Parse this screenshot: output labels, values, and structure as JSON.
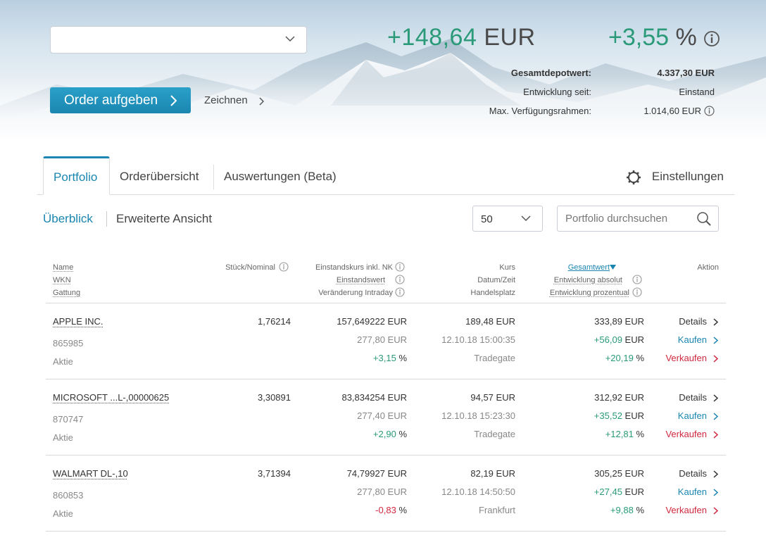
{
  "header": {
    "account_select_value": "",
    "total_change_abs": "+148,64",
    "total_change_abs_currency": "EUR",
    "total_change_pct": "+3,55",
    "total_change_pct_unit": "%",
    "order_button": "Order aufgeben",
    "zeichnen_link": "Zeichnen",
    "stats": [
      {
        "label": "Gesamtdepotwert:",
        "value": "4.337,30 EUR"
      },
      {
        "label": "Entwicklung seit:",
        "value": "Einstand"
      },
      {
        "label": "Max. Verfügungsrahmen:",
        "value": "1.014,60 EUR"
      }
    ]
  },
  "tabs": [
    {
      "label": "Portfolio",
      "active": true
    },
    {
      "label": "Orderübersicht",
      "active": false
    },
    {
      "label": "Auswertungen (Beta)",
      "active": false
    }
  ],
  "settings_label": "Einstellungen",
  "subnav": {
    "overview": "Überblick",
    "extended": "Erweiterte Ansicht"
  },
  "page_size": "50",
  "search_placeholder": "Portfolio durchsuchen",
  "columns": {
    "name": "Name",
    "wkn": "WKN",
    "gattung": "Gattung",
    "stueck": "Stück/Nominal",
    "einstandskurs": "Einstandskurs inkl. NK",
    "einstandswert": "Einstandswert",
    "veraenderung_intraday": "Veränderung Intraday",
    "kurs": "Kurs",
    "datum_zeit": "Datum/Zeit",
    "handelsplatz": "Handelsplatz",
    "gesamtwert": "Gesamtwert",
    "entwicklung_absolut": "Entwicklung absolut",
    "entwicklung_prozentual": "Entwicklung prozentual",
    "aktion": "Aktion"
  },
  "currency": "EUR",
  "pct_unit": "%",
  "actions": {
    "details": "Details",
    "buy": "Kaufen",
    "sell": "Verkaufen"
  },
  "rows": [
    {
      "name": "APPLE INC.",
      "wkn": "865985",
      "gattung": "Aktie",
      "stueck": "1,76214",
      "einstandskurs": "157,649222",
      "einstandswert": "277,80",
      "intraday": "+3,15",
      "kurs": "189,48",
      "datum": "12.10.18 15:00:35",
      "handelsplatz": "Tradegate",
      "gesamtwert": "333,89",
      "entw_abs": "+56,09",
      "entw_pct": "+20,19"
    },
    {
      "name": "MICROSOFT ...L-,00000625",
      "wkn": "870747",
      "gattung": "Aktie",
      "stueck": "3,30891",
      "einstandskurs": "83,834254",
      "einstandswert": "277,40",
      "intraday": "+2,90",
      "kurs": "94,57",
      "datum": "12.10.18 15:23:30",
      "handelsplatz": "Tradegate",
      "gesamtwert": "312,92",
      "entw_abs": "+35,52",
      "entw_pct": "+12,81"
    },
    {
      "name": "WALMART DL-,10",
      "wkn": "860853",
      "gattung": "Aktie",
      "stueck": "3,71394",
      "einstandskurs": "74,79927",
      "einstandswert": "277,80",
      "intraday": "-0,83",
      "kurs": "82,19",
      "datum": "12.10.18 14:50:50",
      "handelsplatz": "Frankfurt",
      "gesamtwert": "305,25",
      "entw_abs": "+27,45",
      "entw_pct": "+9,88"
    }
  ]
}
